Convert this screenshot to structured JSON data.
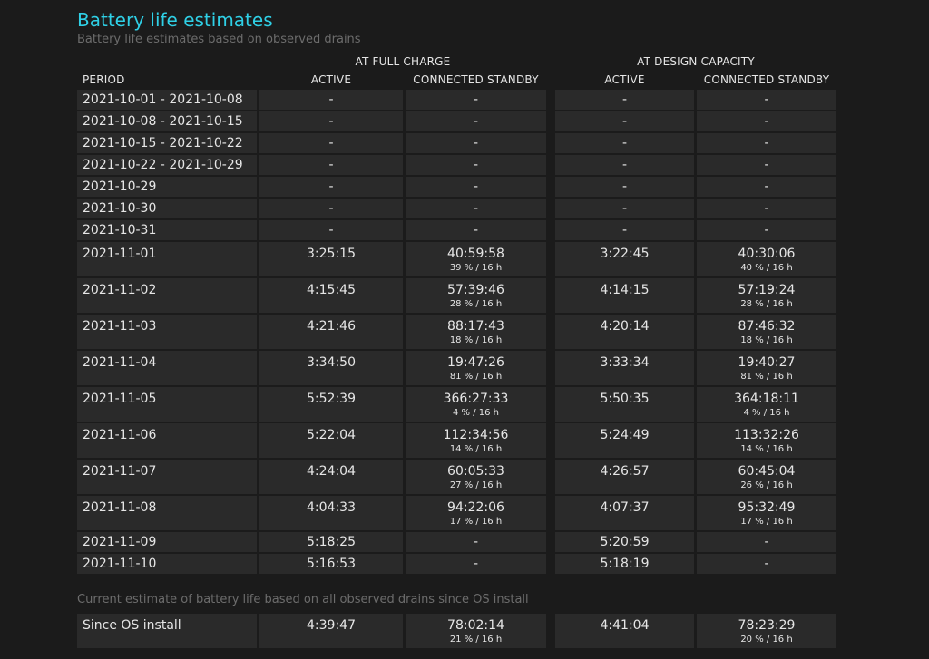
{
  "title": "Battery life estimates",
  "subtitle": "Battery life estimates based on observed drains",
  "headers": {
    "full_charge": "AT FULL CHARGE",
    "design_capacity": "AT DESIGN CAPACITY",
    "period": "PERIOD",
    "active": "ACTIVE",
    "connected_standby": "CONNECTED STANDBY"
  },
  "rows": [
    {
      "period": "2021-10-01 - 2021-10-08",
      "fc_active": "-",
      "fc_cs": "-",
      "fc_cs_sub": "",
      "dc_active": "-",
      "dc_cs": "-",
      "dc_cs_sub": ""
    },
    {
      "period": "2021-10-08 - 2021-10-15",
      "fc_active": "-",
      "fc_cs": "-",
      "fc_cs_sub": "",
      "dc_active": "-",
      "dc_cs": "-",
      "dc_cs_sub": ""
    },
    {
      "period": "2021-10-15 - 2021-10-22",
      "fc_active": "-",
      "fc_cs": "-",
      "fc_cs_sub": "",
      "dc_active": "-",
      "dc_cs": "-",
      "dc_cs_sub": ""
    },
    {
      "period": "2021-10-22 - 2021-10-29",
      "fc_active": "-",
      "fc_cs": "-",
      "fc_cs_sub": "",
      "dc_active": "-",
      "dc_cs": "-",
      "dc_cs_sub": ""
    },
    {
      "period": "2021-10-29",
      "fc_active": "-",
      "fc_cs": "-",
      "fc_cs_sub": "",
      "dc_active": "-",
      "dc_cs": "-",
      "dc_cs_sub": ""
    },
    {
      "period": "2021-10-30",
      "fc_active": "-",
      "fc_cs": "-",
      "fc_cs_sub": "",
      "dc_active": "-",
      "dc_cs": "-",
      "dc_cs_sub": ""
    },
    {
      "period": "2021-10-31",
      "fc_active": "-",
      "fc_cs": "-",
      "fc_cs_sub": "",
      "dc_active": "-",
      "dc_cs": "-",
      "dc_cs_sub": ""
    },
    {
      "period": "2021-11-01",
      "fc_active": "3:25:15",
      "fc_cs": "40:59:58",
      "fc_cs_sub": "39 % / 16 h",
      "dc_active": "3:22:45",
      "dc_cs": "40:30:06",
      "dc_cs_sub": "40 % / 16 h"
    },
    {
      "period": "2021-11-02",
      "fc_active": "4:15:45",
      "fc_cs": "57:39:46",
      "fc_cs_sub": "28 % / 16 h",
      "dc_active": "4:14:15",
      "dc_cs": "57:19:24",
      "dc_cs_sub": "28 % / 16 h"
    },
    {
      "period": "2021-11-03",
      "fc_active": "4:21:46",
      "fc_cs": "88:17:43",
      "fc_cs_sub": "18 % / 16 h",
      "dc_active": "4:20:14",
      "dc_cs": "87:46:32",
      "dc_cs_sub": "18 % / 16 h"
    },
    {
      "period": "2021-11-04",
      "fc_active": "3:34:50",
      "fc_cs": "19:47:26",
      "fc_cs_sub": "81 % / 16 h",
      "dc_active": "3:33:34",
      "dc_cs": "19:40:27",
      "dc_cs_sub": "81 % / 16 h"
    },
    {
      "period": "2021-11-05",
      "fc_active": "5:52:39",
      "fc_cs": "366:27:33",
      "fc_cs_sub": "4 % / 16 h",
      "dc_active": "5:50:35",
      "dc_cs": "364:18:11",
      "dc_cs_sub": "4 % / 16 h"
    },
    {
      "period": "2021-11-06",
      "fc_active": "5:22:04",
      "fc_cs": "112:34:56",
      "fc_cs_sub": "14 % / 16 h",
      "dc_active": "5:24:49",
      "dc_cs": "113:32:26",
      "dc_cs_sub": "14 % / 16 h"
    },
    {
      "period": "2021-11-07",
      "fc_active": "4:24:04",
      "fc_cs": "60:05:33",
      "fc_cs_sub": "27 % / 16 h",
      "dc_active": "4:26:57",
      "dc_cs": "60:45:04",
      "dc_cs_sub": "26 % / 16 h"
    },
    {
      "period": "2021-11-08",
      "fc_active": "4:04:33",
      "fc_cs": "94:22:06",
      "fc_cs_sub": "17 % / 16 h",
      "dc_active": "4:07:37",
      "dc_cs": "95:32:49",
      "dc_cs_sub": "17 % / 16 h"
    },
    {
      "period": "2021-11-09",
      "fc_active": "5:18:25",
      "fc_cs": "-",
      "fc_cs_sub": "",
      "dc_active": "5:20:59",
      "dc_cs": "-",
      "dc_cs_sub": ""
    },
    {
      "period": "2021-11-10",
      "fc_active": "5:16:53",
      "fc_cs": "-",
      "fc_cs_sub": "",
      "dc_active": "5:18:19",
      "dc_cs": "-",
      "dc_cs_sub": ""
    }
  ],
  "current_estimate": {
    "label": "Current estimate of battery life based on all observed drains since OS install",
    "period": "Since OS install",
    "fc_active": "4:39:47",
    "fc_cs": "78:02:14",
    "fc_cs_sub": "21 % / 16 h",
    "dc_active": "4:41:04",
    "dc_cs": "78:23:29",
    "dc_cs_sub": "20 % / 16 h"
  },
  "colors": {
    "title": "#2fd0e6",
    "cell_bg": "#2a2a2a",
    "page_bg": "#1b1b1b",
    "muted": "#6c6c6c"
  }
}
